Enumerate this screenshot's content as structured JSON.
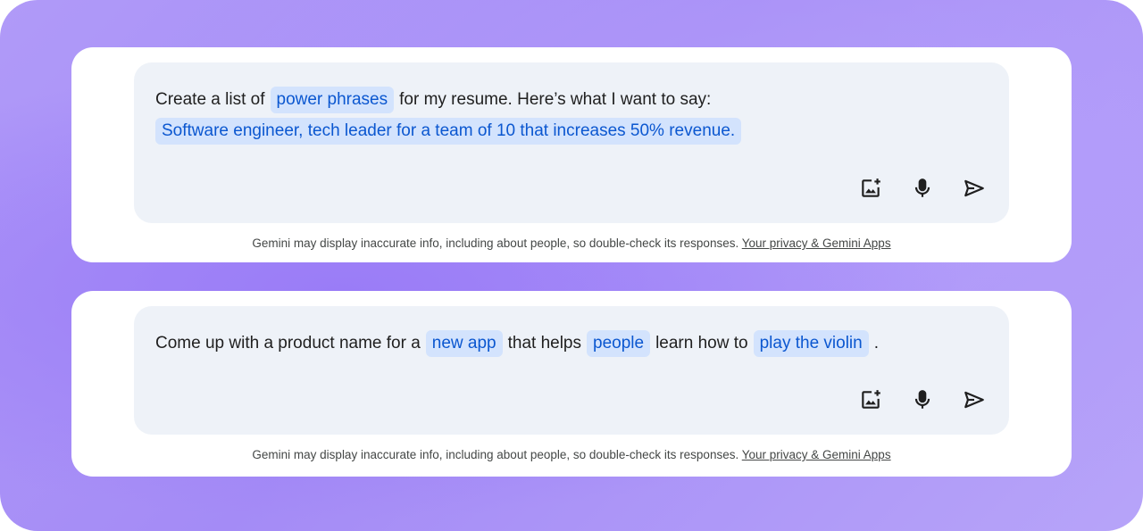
{
  "cards": [
    {
      "prompt_lines": [
        [
          {
            "type": "text",
            "value": "Create a list of"
          },
          {
            "type": "chip",
            "value": "power phrases"
          },
          {
            "type": "text",
            "value": "for my resume. Here’s what I want to say:"
          }
        ],
        [
          {
            "type": "chip",
            "value": "Software engineer, tech leader for a team of 10 that increases 50% revenue."
          }
        ]
      ],
      "disclaimer": "Gemini may display inaccurate info, including about people, so double-check its responses.",
      "privacy_link": "Your privacy & Gemini Apps"
    },
    {
      "prompt_lines": [
        [
          {
            "type": "text",
            "value": "Come up with a product name for a"
          },
          {
            "type": "chip",
            "value": "new app"
          },
          {
            "type": "text",
            "value": "that helps"
          },
          {
            "type": "chip",
            "value": "people"
          },
          {
            "type": "text",
            "value": "learn how to"
          },
          {
            "type": "chip",
            "value": "play the violin"
          },
          {
            "type": "text",
            "value": "."
          }
        ]
      ],
      "disclaimer": "Gemini may display inaccurate info, including about people, so double-check its responses.",
      "privacy_link": "Your privacy & Gemini Apps"
    }
  ],
  "icons": {
    "add_image": "add-image-icon",
    "mic": "microphone-icon",
    "send": "send-icon"
  },
  "colors": {
    "chip_bg": "#d3e3fd",
    "chip_text": "#0b57d0",
    "prompt_bg": "#eef2f8",
    "background_purple": "#a48bf6"
  }
}
